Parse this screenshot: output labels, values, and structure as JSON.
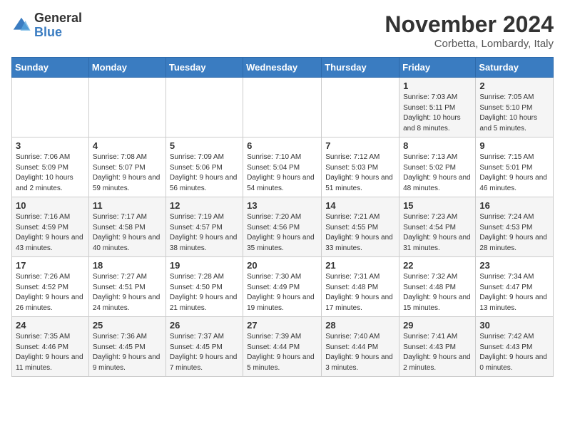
{
  "logo": {
    "general": "General",
    "blue": "Blue"
  },
  "header": {
    "month_year": "November 2024",
    "location": "Corbetta, Lombardy, Italy"
  },
  "weekdays": [
    "Sunday",
    "Monday",
    "Tuesday",
    "Wednesday",
    "Thursday",
    "Friday",
    "Saturday"
  ],
  "weeks": [
    [
      {
        "day": "",
        "info": ""
      },
      {
        "day": "",
        "info": ""
      },
      {
        "day": "",
        "info": ""
      },
      {
        "day": "",
        "info": ""
      },
      {
        "day": "",
        "info": ""
      },
      {
        "day": "1",
        "info": "Sunrise: 7:03 AM\nSunset: 5:11 PM\nDaylight: 10 hours and 8 minutes."
      },
      {
        "day": "2",
        "info": "Sunrise: 7:05 AM\nSunset: 5:10 PM\nDaylight: 10 hours and 5 minutes."
      }
    ],
    [
      {
        "day": "3",
        "info": "Sunrise: 7:06 AM\nSunset: 5:09 PM\nDaylight: 10 hours and 2 minutes."
      },
      {
        "day": "4",
        "info": "Sunrise: 7:08 AM\nSunset: 5:07 PM\nDaylight: 9 hours and 59 minutes."
      },
      {
        "day": "5",
        "info": "Sunrise: 7:09 AM\nSunset: 5:06 PM\nDaylight: 9 hours and 56 minutes."
      },
      {
        "day": "6",
        "info": "Sunrise: 7:10 AM\nSunset: 5:04 PM\nDaylight: 9 hours and 54 minutes."
      },
      {
        "day": "7",
        "info": "Sunrise: 7:12 AM\nSunset: 5:03 PM\nDaylight: 9 hours and 51 minutes."
      },
      {
        "day": "8",
        "info": "Sunrise: 7:13 AM\nSunset: 5:02 PM\nDaylight: 9 hours and 48 minutes."
      },
      {
        "day": "9",
        "info": "Sunrise: 7:15 AM\nSunset: 5:01 PM\nDaylight: 9 hours and 46 minutes."
      }
    ],
    [
      {
        "day": "10",
        "info": "Sunrise: 7:16 AM\nSunset: 4:59 PM\nDaylight: 9 hours and 43 minutes."
      },
      {
        "day": "11",
        "info": "Sunrise: 7:17 AM\nSunset: 4:58 PM\nDaylight: 9 hours and 40 minutes."
      },
      {
        "day": "12",
        "info": "Sunrise: 7:19 AM\nSunset: 4:57 PM\nDaylight: 9 hours and 38 minutes."
      },
      {
        "day": "13",
        "info": "Sunrise: 7:20 AM\nSunset: 4:56 PM\nDaylight: 9 hours and 35 minutes."
      },
      {
        "day": "14",
        "info": "Sunrise: 7:21 AM\nSunset: 4:55 PM\nDaylight: 9 hours and 33 minutes."
      },
      {
        "day": "15",
        "info": "Sunrise: 7:23 AM\nSunset: 4:54 PM\nDaylight: 9 hours and 31 minutes."
      },
      {
        "day": "16",
        "info": "Sunrise: 7:24 AM\nSunset: 4:53 PM\nDaylight: 9 hours and 28 minutes."
      }
    ],
    [
      {
        "day": "17",
        "info": "Sunrise: 7:26 AM\nSunset: 4:52 PM\nDaylight: 9 hours and 26 minutes."
      },
      {
        "day": "18",
        "info": "Sunrise: 7:27 AM\nSunset: 4:51 PM\nDaylight: 9 hours and 24 minutes."
      },
      {
        "day": "19",
        "info": "Sunrise: 7:28 AM\nSunset: 4:50 PM\nDaylight: 9 hours and 21 minutes."
      },
      {
        "day": "20",
        "info": "Sunrise: 7:30 AM\nSunset: 4:49 PM\nDaylight: 9 hours and 19 minutes."
      },
      {
        "day": "21",
        "info": "Sunrise: 7:31 AM\nSunset: 4:48 PM\nDaylight: 9 hours and 17 minutes."
      },
      {
        "day": "22",
        "info": "Sunrise: 7:32 AM\nSunset: 4:48 PM\nDaylight: 9 hours and 15 minutes."
      },
      {
        "day": "23",
        "info": "Sunrise: 7:34 AM\nSunset: 4:47 PM\nDaylight: 9 hours and 13 minutes."
      }
    ],
    [
      {
        "day": "24",
        "info": "Sunrise: 7:35 AM\nSunset: 4:46 PM\nDaylight: 9 hours and 11 minutes."
      },
      {
        "day": "25",
        "info": "Sunrise: 7:36 AM\nSunset: 4:45 PM\nDaylight: 9 hours and 9 minutes."
      },
      {
        "day": "26",
        "info": "Sunrise: 7:37 AM\nSunset: 4:45 PM\nDaylight: 9 hours and 7 minutes."
      },
      {
        "day": "27",
        "info": "Sunrise: 7:39 AM\nSunset: 4:44 PM\nDaylight: 9 hours and 5 minutes."
      },
      {
        "day": "28",
        "info": "Sunrise: 7:40 AM\nSunset: 4:44 PM\nDaylight: 9 hours and 3 minutes."
      },
      {
        "day": "29",
        "info": "Sunrise: 7:41 AM\nSunset: 4:43 PM\nDaylight: 9 hours and 2 minutes."
      },
      {
        "day": "30",
        "info": "Sunrise: 7:42 AM\nSunset: 4:43 PM\nDaylight: 9 hours and 0 minutes."
      }
    ]
  ]
}
